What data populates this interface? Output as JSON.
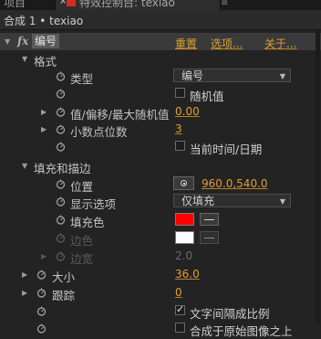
{
  "tabs": {
    "left_label": "项目",
    "active_label": "特效控制台: texiao"
  },
  "panel_title": "合成 1 • texiao",
  "effect": {
    "name": "编号",
    "reset_label": "重置",
    "options_label": "选项...",
    "about_label": "关于..."
  },
  "groups": {
    "format": "格式",
    "fill_stroke": "填充和描边"
  },
  "props": {
    "type": {
      "label": "类型",
      "value": "编号"
    },
    "random": {
      "label": "随机值",
      "checked": false
    },
    "offset": {
      "label": "值/偏移/最大随机值",
      "value": "0.00"
    },
    "decimals": {
      "label": "小数点位数",
      "value": "3"
    },
    "current_time": {
      "label": "当前时间/日期",
      "checked": false
    },
    "position": {
      "label": "位置",
      "value": "960.0,540.0"
    },
    "display_options": {
      "label": "显示选项",
      "value": "仅填充"
    },
    "fill_color": {
      "label": "填充色",
      "color": "#ff0000"
    },
    "stroke_color": {
      "label": "边色",
      "color": "#ffffff"
    },
    "stroke_width": {
      "label": "边宽",
      "value": "2.0"
    },
    "size": {
      "label": "大小",
      "value": "36.0"
    },
    "tracking": {
      "label": "跟踪",
      "value": "0"
    },
    "proportional_spacing": {
      "label": "文字间隔成比例",
      "checked": true
    },
    "composite_original": {
      "label": "合成于原始图像之上",
      "checked": false
    }
  },
  "colors": {
    "accent": "#e0a030",
    "background": "#232323"
  }
}
